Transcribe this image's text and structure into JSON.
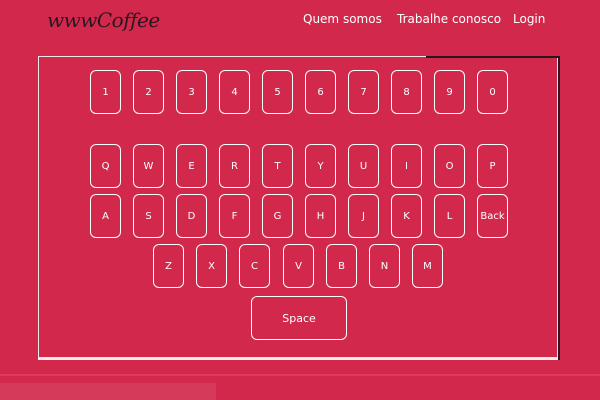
{
  "header": {
    "logo": "wwwCoffee",
    "nav": [
      "Quem somos",
      "Trabalhe conosco",
      "Login"
    ]
  },
  "keyboard": {
    "row_numbers": [
      "1",
      "2",
      "3",
      "4",
      "5",
      "6",
      "7",
      "8",
      "9",
      "0"
    ],
    "row_top": [
      "Q",
      "W",
      "E",
      "R",
      "T",
      "Y",
      "U",
      "I",
      "O",
      "P"
    ],
    "row_middle": [
      "A",
      "S",
      "D",
      "F",
      "G",
      "H",
      "J",
      "K",
      "L",
      "Back"
    ],
    "row_bottom": [
      "Z",
      "X",
      "C",
      "V",
      "B",
      "N",
      "M"
    ],
    "space": "Space"
  },
  "colors": {
    "background": "#d2284c",
    "key_border": "#ffffff",
    "logo": "#2a1620"
  }
}
